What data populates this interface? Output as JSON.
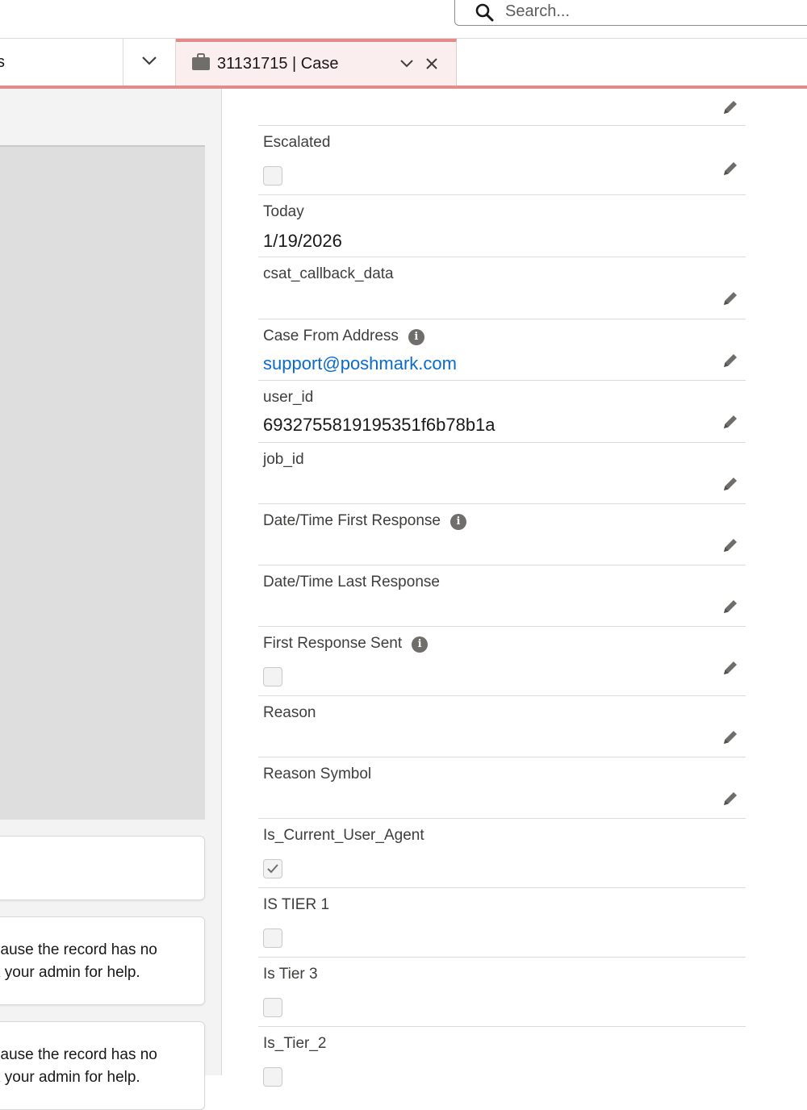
{
  "search": {
    "placeholder": "Search..."
  },
  "tabs": {
    "previous_label": "s",
    "active_title": "31131715 | Case"
  },
  "left": {
    "card2_lines": [
      "cause the record has no",
      "k your admin for help."
    ],
    "card3_lines": [
      "cause the record has no",
      "k your admin for help."
    ]
  },
  "fields": [
    {
      "label": "",
      "type": "text",
      "value": "",
      "info": false
    },
    {
      "label": "Escalated",
      "type": "checkbox",
      "checked": false,
      "info": false
    },
    {
      "label": "Today",
      "type": "text",
      "value": "1/19/2026",
      "info": false,
      "editable": false
    },
    {
      "label": "csat_callback_data",
      "type": "text",
      "value": "",
      "info": false
    },
    {
      "label": "Case From Address",
      "type": "link",
      "value": "support@poshmark.com",
      "info": true
    },
    {
      "label": "user_id",
      "type": "text",
      "value": "6932755819195351f6b78b1a",
      "info": false
    },
    {
      "label": "job_id",
      "type": "text",
      "value": "",
      "info": false
    },
    {
      "label": "Date/Time First Response",
      "type": "text",
      "value": "",
      "info": true
    },
    {
      "label": "Date/Time Last Response",
      "type": "text",
      "value": "",
      "info": false
    },
    {
      "label": "First Response Sent",
      "type": "checkbox",
      "checked": false,
      "info": true
    },
    {
      "label": "Reason",
      "type": "text",
      "value": "",
      "info": false
    },
    {
      "label": "Reason Symbol",
      "type": "text",
      "value": "",
      "info": false
    },
    {
      "label": "Is_Current_User_Agent",
      "type": "checkbox",
      "checked": true,
      "info": false,
      "editable": false
    },
    {
      "label": "IS TIER 1",
      "type": "checkbox",
      "checked": false,
      "info": false,
      "editable": false
    },
    {
      "label": "Is Tier 3",
      "type": "checkbox",
      "checked": false,
      "info": false,
      "editable": false
    },
    {
      "label": "Is_Tier_2",
      "type": "checkbox",
      "checked": false,
      "info": false,
      "editable": false
    }
  ],
  "colors": {
    "accent": "#e38b8b",
    "link": "#0b6bcb",
    "divider": "#dddbda"
  },
  "icons": {
    "search": "search-icon",
    "case": "briefcase-icon",
    "edit": "pencil-icon",
    "info": "info-icon",
    "close": "close-icon",
    "chevron": "chevron-down-icon"
  }
}
